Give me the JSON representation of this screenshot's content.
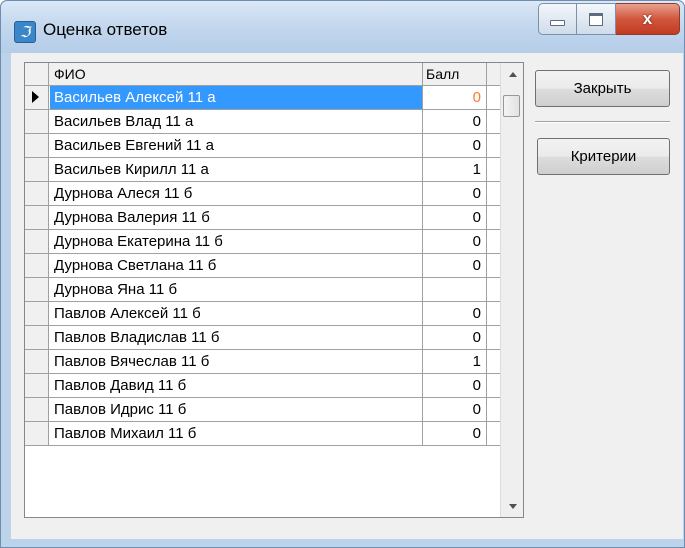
{
  "window": {
    "title": "Оценка ответов",
    "icon_glyph": "ℑ"
  },
  "caption": {
    "close_glyph": "x"
  },
  "grid": {
    "columns": [
      "ФИО",
      "Балл"
    ],
    "selected_index": 0,
    "rows": [
      {
        "fio": "Васильев Алексей 11 а",
        "ball": "0"
      },
      {
        "fio": "Васильев Влад 11 а",
        "ball": "0"
      },
      {
        "fio": "Васильев Евгений 11 а",
        "ball": "0"
      },
      {
        "fio": "Васильев Кирилл 11 а",
        "ball": "1"
      },
      {
        "fio": "Дурнова Алеся 11 б",
        "ball": "0"
      },
      {
        "fio": "Дурнова Валерия 11 б",
        "ball": "0"
      },
      {
        "fio": "Дурнова Екатерина 11 б",
        "ball": "0"
      },
      {
        "fio": "Дурнова Светлана 11 б",
        "ball": "0"
      },
      {
        "fio": "Дурнова Яна 11 б",
        "ball": ""
      },
      {
        "fio": "Павлов Алексей 11 б",
        "ball": "0"
      },
      {
        "fio": "Павлов Владислав 11 б",
        "ball": "0"
      },
      {
        "fio": "Павлов Вячеслав 11 б",
        "ball": "1"
      },
      {
        "fio": "Павлов Давид 11 б",
        "ball": "0"
      },
      {
        "fio": "Павлов Идрис 11 б",
        "ball": "0"
      },
      {
        "fio": "Павлов Михаил 11 б",
        "ball": "0"
      }
    ]
  },
  "buttons": {
    "close_label": "Закрыть",
    "criteria_label": "Критерии"
  },
  "colors": {
    "selection": "#3399ff",
    "window_frame": "#bcd3ea",
    "close_button": "#c23a21"
  }
}
